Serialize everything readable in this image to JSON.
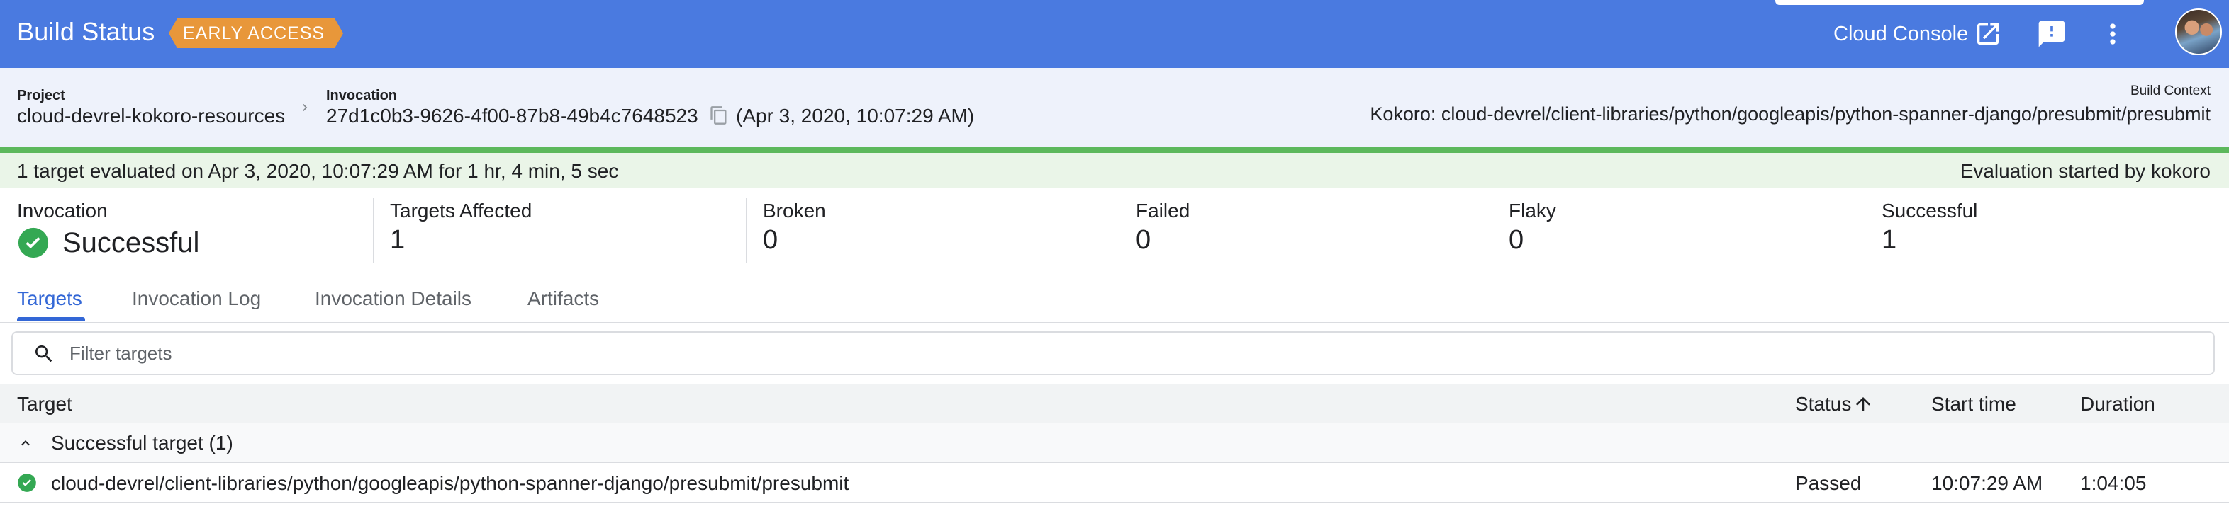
{
  "appbar": {
    "title": "Build Status",
    "badge": "EARLY ACCESS",
    "cloud_console_label": "Cloud Console",
    "icons": [
      "open-in-new-icon",
      "feedback-icon",
      "more-vert-icon"
    ],
    "colors": {
      "bar": "#4a7ae0",
      "badge": "#e8973a"
    }
  },
  "header": {
    "project_label": "Project",
    "project_value": "cloud-devrel-kokoro-resources",
    "invocation_label": "Invocation",
    "invocation_id": "27d1c0b3-9626-4f00-87b8-49b4c7648523",
    "invocation_time": "(Apr 3, 2020, 10:07:29 AM)",
    "build_context_label": "Build Context",
    "build_context_value": "Kokoro: cloud-devrel/client-libraries/python/googleapis/python-spanner-django/presubmit/presubmit"
  },
  "evaluation": {
    "summary": "1 target evaluated on Apr 3, 2020, 10:07:29 AM for 1 hr, 4 min, 5 sec",
    "started_by": "Evaluation started by kokoro",
    "color": "#5cb85c"
  },
  "summary": {
    "invocation_label": "Invocation",
    "invocation_status": "Successful",
    "cards": [
      {
        "label": "Targets Affected",
        "value": "1"
      },
      {
        "label": "Broken",
        "value": "0"
      },
      {
        "label": "Failed",
        "value": "0"
      },
      {
        "label": "Flaky",
        "value": "0"
      },
      {
        "label": "Successful",
        "value": "1"
      }
    ]
  },
  "tabs": [
    {
      "label": "Targets",
      "active": true
    },
    {
      "label": "Invocation Log",
      "active": false
    },
    {
      "label": "Invocation Details",
      "active": false
    },
    {
      "label": "Artifacts",
      "active": false
    }
  ],
  "filter": {
    "placeholder": "Filter targets"
  },
  "table": {
    "columns": [
      "Target",
      "Status",
      "Start time",
      "Duration"
    ],
    "sort": {
      "column": "Status",
      "direction": "ascending"
    },
    "group": {
      "label": "Successful target (1)",
      "expanded": true
    },
    "rows": [
      {
        "target": "cloud-devrel/client-libraries/python/googleapis/python-spanner-django/presubmit/presubmit",
        "status": "Passed",
        "start_time": "10:07:29 AM",
        "duration": "1:04:05"
      }
    ]
  }
}
